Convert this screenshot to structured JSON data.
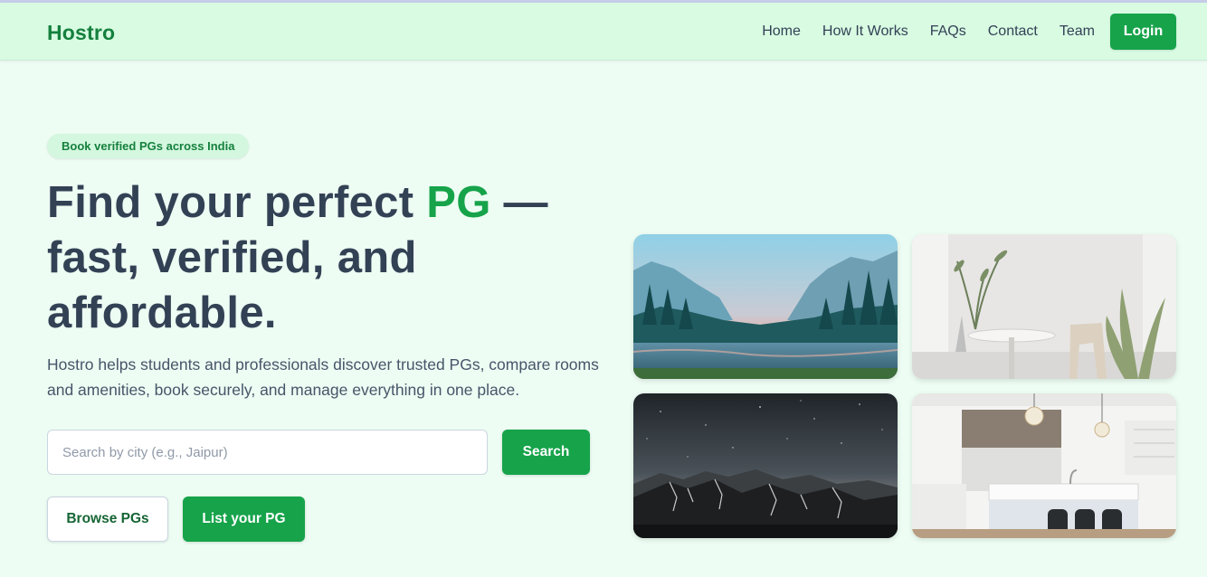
{
  "brand": {
    "name": "Hostro"
  },
  "nav": {
    "links": [
      "Home",
      "How It Works",
      "FAQs",
      "Contact",
      "Team"
    ],
    "login_label": "Login"
  },
  "hero": {
    "badge": "Book verified PGs across India",
    "headline_before": "Find your perfect ",
    "headline_accent": "PG",
    "headline_after": " — fast, verified, and affordable.",
    "subtext": "Hostro helps students and professionals discover trusted PGs, compare rooms and amenities, book securely, and manage everything in one place.",
    "search": {
      "placeholder": "Search by city (e.g., Jaipur)",
      "value": "",
      "button_label": "Search"
    },
    "browse_label": "Browse PGs",
    "list_label": "List your PG"
  },
  "colors": {
    "brand": "#15803d",
    "accent": "#16a34a",
    "page_bg": "#edfdf3",
    "nav_bg": "#d8fbe2"
  },
  "gallery": {
    "images": [
      "mountain-lake-photo",
      "interior-dining-photo",
      "night-mountain-photo",
      "kitchen-interior-photo"
    ]
  }
}
